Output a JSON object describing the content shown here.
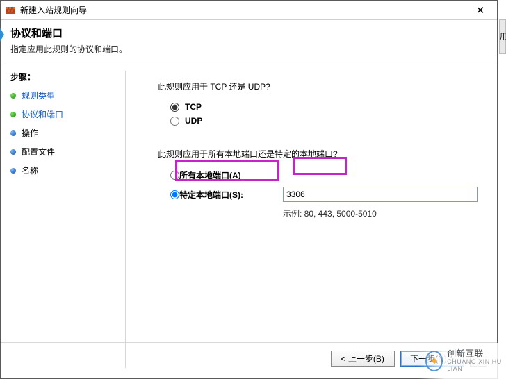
{
  "window": {
    "title": "新建入站规则向导",
    "close_glyph": "✕"
  },
  "header": {
    "title": "协议和端口",
    "subtitle": "指定应用此规则的协议和端口。"
  },
  "steps": {
    "title": "步骤：",
    "items": [
      {
        "label": "规则类型",
        "state": "done"
      },
      {
        "label": "协议和端口",
        "state": "current"
      },
      {
        "label": "操作",
        "state": "todo"
      },
      {
        "label": "配置文件",
        "state": "todo"
      },
      {
        "label": "名称",
        "state": "todo"
      }
    ]
  },
  "content": {
    "protocol_question": "此规则应用于 TCP 还是 UDP?",
    "option_tcp": "TCP",
    "option_udp": "UDP",
    "protocol_selected": "tcp",
    "port_question": "此规则应用于所有本地端口还是特定的本地端口?",
    "option_all_ports": "所有本地端口(A)",
    "option_specific_ports": "特定本地端口(S):",
    "port_scope_selected": "specific",
    "port_value": "3306",
    "port_example": "示例: 80, 443, 5000-5010"
  },
  "footer": {
    "back": "< 上一步(B)",
    "next": "下一步(N) >"
  },
  "misc": {
    "side_char": "用",
    "watermark_main": "创新互联",
    "watermark_sub": "CHUANG XIN HU LIAN"
  },
  "colors": {
    "highlight": "#c722cc",
    "link": "#0a5bcc"
  }
}
